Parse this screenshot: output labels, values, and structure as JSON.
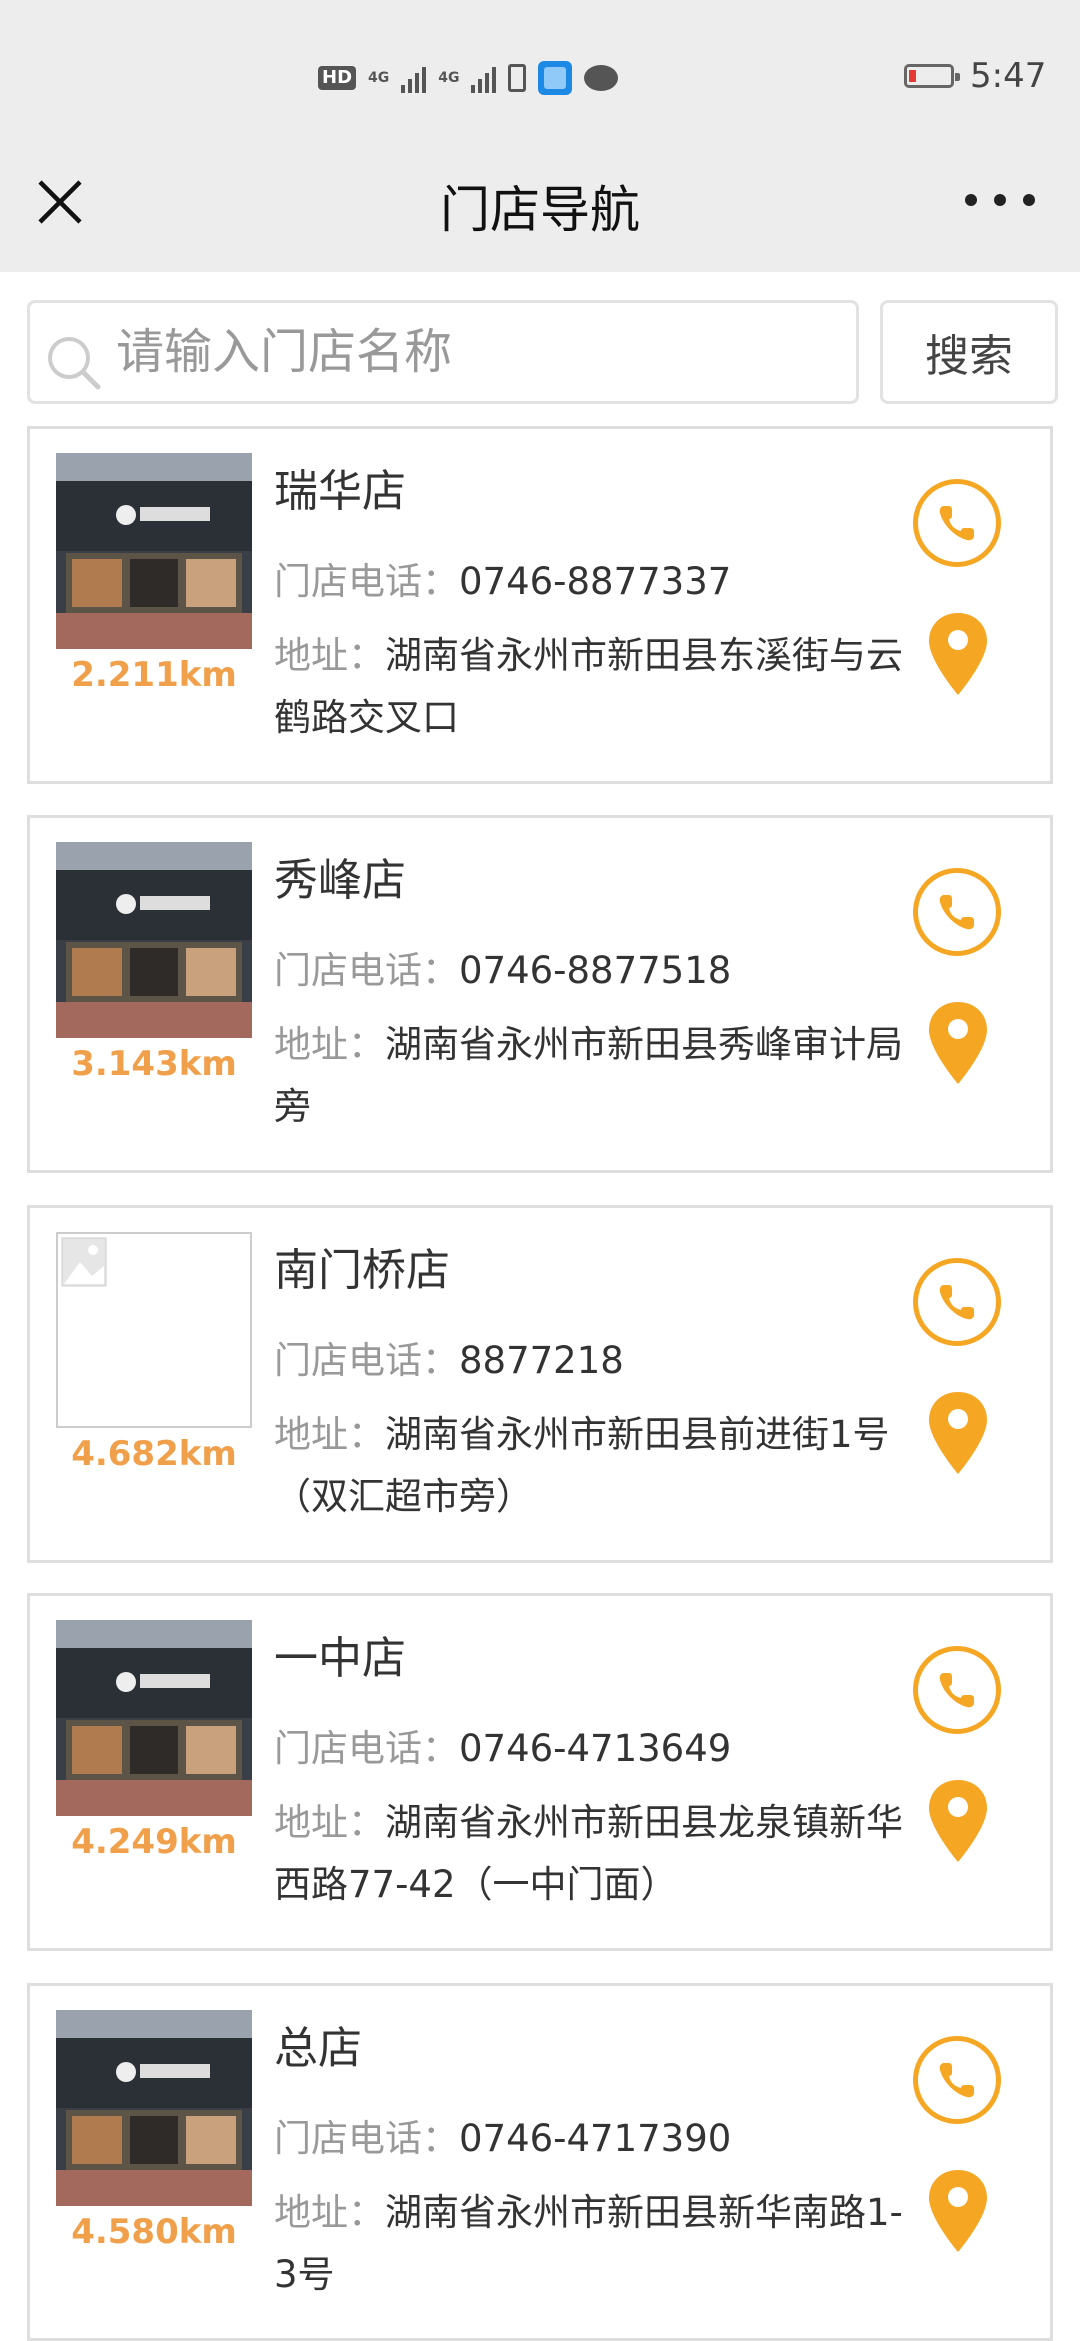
{
  "status_bar": {
    "time": "5:47",
    "hd": "HD",
    "net1": "4G",
    "net2": "4G"
  },
  "header": {
    "title": "门店导航"
  },
  "search": {
    "placeholder": "请输入门店名称",
    "button_label": "搜索"
  },
  "labels": {
    "phone": "门店电话：",
    "address": "地址："
  },
  "colors": {
    "accent": "#f5a623",
    "distance": "#f0a04a"
  },
  "stores": [
    {
      "name": "瑞华店",
      "phone": "0746-8877337",
      "address": "湖南省永州市新田县东溪街与云鹤路交叉口",
      "distance": "2.211km"
    },
    {
      "name": "秀峰店",
      "phone": "0746-8877518",
      "address": "湖南省永州市新田县秀峰审计局旁",
      "distance": "3.143km"
    },
    {
      "name": "南门桥店",
      "phone": "8877218",
      "address": "湖南省永州市新田县前进街1号（双汇超市旁）",
      "distance": "4.682km"
    },
    {
      "name": "一中店",
      "phone": "0746-4713649",
      "address": "湖南省永州市新田县龙泉镇新华西路77-42（一中门面）",
      "distance": "4.249km"
    },
    {
      "name": "总店",
      "phone": "0746-4717390",
      "address": "湖南省永州市新田县新华南路1-3号",
      "distance": "4.580km"
    }
  ]
}
